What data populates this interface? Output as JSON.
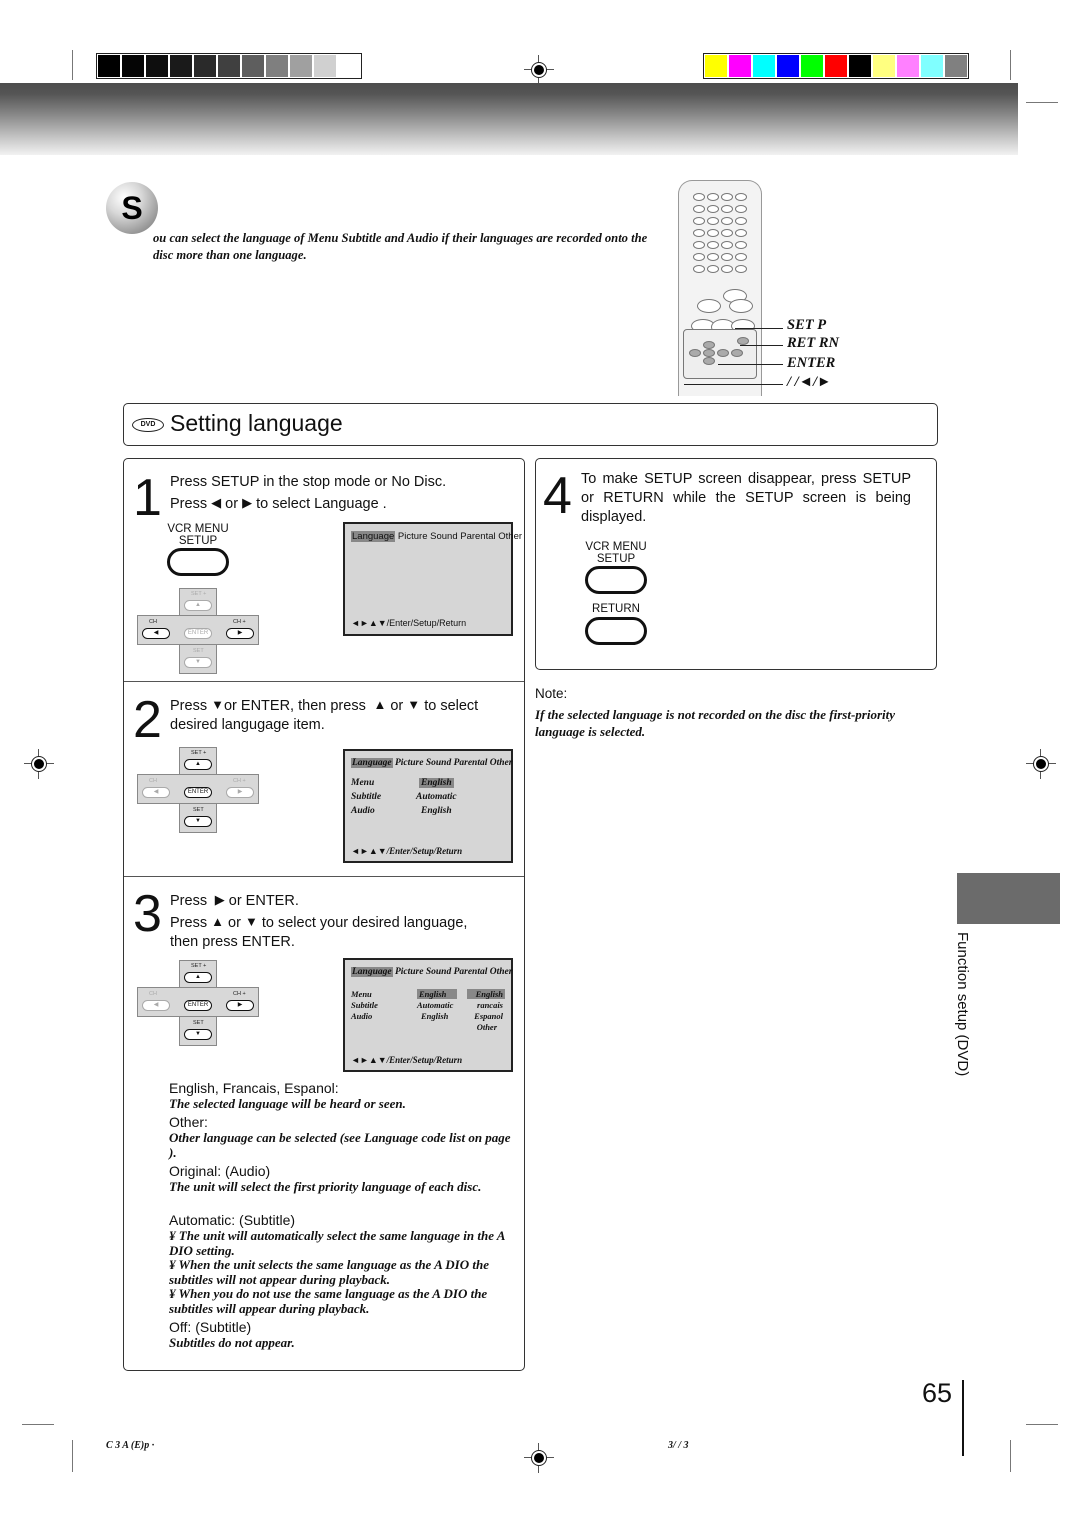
{
  "print_marks": {
    "grayscale_bar": [
      "#000000",
      "#050505",
      "#0e0e0e",
      "#1a1a1a",
      "#2a2a2a",
      "#404040",
      "#5e5e5e",
      "#7f7f7f",
      "#a0a0a0",
      "#d0d0d0",
      "#ffffff"
    ],
    "color_bar": [
      "#ffff00",
      "#ff00ff",
      "#00ffff",
      "#0000ff",
      "#00ff00",
      "#ff0000",
      "#000000",
      "#ffff80",
      "#ff80ff",
      "#80ffff",
      "#808080"
    ]
  },
  "intro": {
    "badge_letter": "S",
    "text": "ou can select the language of    Menu    Subtitle   and   Audio   if their languages are recorded onto the disc more than one language."
  },
  "remote_callouts": {
    "setup": "SET   P",
    "return": "RET   RN",
    "enter": "ENTER",
    "arrows": "/     /◄/►"
  },
  "section": {
    "logo": "DVD",
    "title": "Setting language"
  },
  "step1": {
    "number": "1",
    "line1": "Press SETUP in the stop mode or No Disc.",
    "line2_pre": "Press",
    "line2_mid": "or",
    "line2_post": "to select    Language   .",
    "button_label_1": "VCR MENU",
    "button_label_2": "SETUP",
    "dpad": {
      "up": "SET +",
      "left": "CH",
      "right": "CH +",
      "center": "ENTER",
      "down": "SET"
    },
    "osd": {
      "tabs_selected": "Language",
      "tabs_rest": " Picture Sound Parental Other",
      "footer": "◄►▲▼/Enter/Setup/Return"
    }
  },
  "step2": {
    "number": "2",
    "line1_a": "Press",
    "line1_b": "or ENTER, then press",
    "line1_c": "or",
    "line1_d": "to select",
    "line2": "desired langugage item.",
    "osd": {
      "tabs_selected": "Language",
      "tabs_rest": " Picture   Sound Parental Other",
      "rows": [
        {
          "label": "Menu",
          "value": "English",
          "highlighted": true
        },
        {
          "label": "Subtitle",
          "value": "Automatic",
          "highlighted": false
        },
        {
          "label": "Audio",
          "value": "English",
          "highlighted": false
        }
      ],
      "footer": "◄►▲▼/Enter/Setup/Return"
    }
  },
  "step3": {
    "number": "3",
    "line1_a": "Press",
    "line1_b": "or ENTER.",
    "line2_a": "Press",
    "line2_b": "or",
    "line2_c": "to select your desired language,",
    "line3": "then press ENTER.",
    "osd": {
      "tabs_selected": "Language",
      "tabs_rest": " Picture   Sound Parental Other",
      "rows": [
        {
          "label": "Menu",
          "value": "English"
        },
        {
          "label": "Subtitle",
          "value": "Automatic"
        },
        {
          "label": "Audio",
          "value": "English"
        }
      ],
      "options": [
        "English",
        "rancais",
        "Espanol",
        "Other"
      ],
      "footer": "◄►▲▼/Enter/Setup/Return"
    }
  },
  "options_help": [
    {
      "heading": "English, Francais, Espanol:",
      "body": "The selected language will be heard or seen."
    },
    {
      "heading": "Other:",
      "body": "Other language can be selected (see        Language code list  on page     )."
    },
    {
      "heading": "Original: (Audio)",
      "body": "The unit will select the first priority language of each disc."
    },
    {
      "heading": "Automatic: (Subtitle)",
      "bullets": [
        "¥ The unit will automatically select the    same language in the A   DIO setting.",
        "¥ When the unit selects the same language as the        A   DIO the subtitles  will not appear during playback.",
        "¥ When you do not use the same language as       the A   DIO the subtitles  will appear during playback."
      ]
    },
    {
      "heading": "Off: (Subtitle)",
      "body": "Subtitles do not appear."
    }
  ],
  "step4": {
    "number": "4",
    "text": "To make SETUP screen disappear, press SETUP or RETURN while the SETUP screen is being displayed.",
    "button1_label_1": "VCR MENU",
    "button1_label_2": "SETUP",
    "button2_label": "RETURN"
  },
  "note": {
    "heading": "Note:",
    "body": "If the selected language is not recorded on the disc  the first-priority language is selected."
  },
  "side_tab": {
    "label": "Function setup  (DVD)"
  },
  "page_number": "65",
  "footer": {
    "left_code": "C 3    A (E)p   ·",
    "right_code": "3/   /        3"
  }
}
